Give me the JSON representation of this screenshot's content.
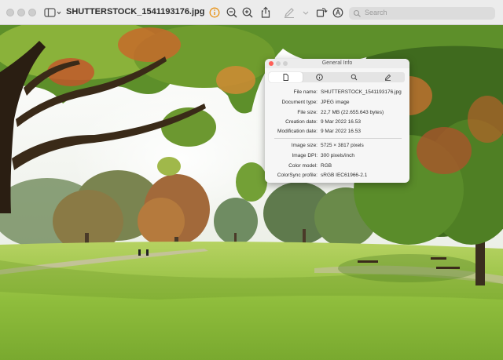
{
  "window": {
    "title": "SHUTTERSTOCK_1541193176.jpg",
    "search_placeholder": "Search"
  },
  "toolbar": {
    "icons": [
      "sidebar-icon",
      "info-icon",
      "zoom-out-icon",
      "zoom-in-icon",
      "share-icon",
      "markup-pen-icon",
      "rotate-icon",
      "annotate-icon",
      "search-icon"
    ]
  },
  "info_panel": {
    "title": "General Info",
    "tabs": [
      "general-tab",
      "more-info-tab",
      "search-tab",
      "edit-tab"
    ],
    "rows": [
      {
        "label": "File name:",
        "value": "SHUTTERSTOCK_1541193176.jpg"
      },
      {
        "label": "Document type:",
        "value": "JPEG image"
      },
      {
        "label": "File size:",
        "value": "22,7 MB (22.655.643 bytes)"
      },
      {
        "label": "Creation date:",
        "value": "9 Mar 2022 16.53"
      },
      {
        "label": "Modification date:",
        "value": "9 Mar 2022 16.53"
      },
      {
        "label": "Image size:",
        "value": "5725 × 3817 pixels"
      },
      {
        "label": "Image DPI:",
        "value": "300 pixels/inch"
      },
      {
        "label": "Color model:",
        "value": "RGB"
      },
      {
        "label": "ColorSync profile:",
        "value": "sRGB IEC61966-2.1"
      }
    ]
  },
  "colors": {
    "info_accent": "#e8941a",
    "close_red": "#ff5f57",
    "grass": "#9fc94a"
  }
}
